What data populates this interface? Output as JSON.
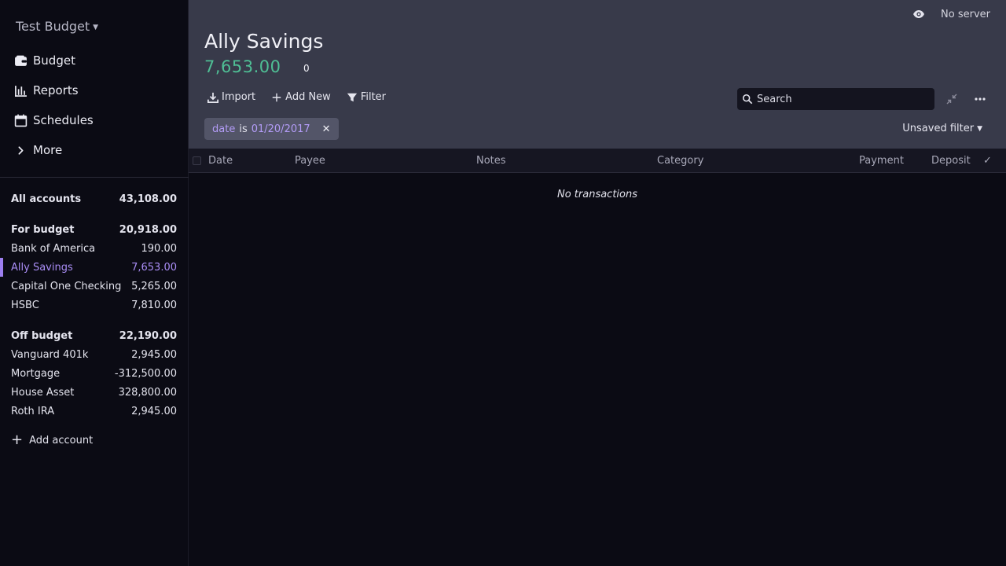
{
  "sidebar": {
    "budget_name": "Test Budget",
    "nav": [
      {
        "label": "Budget",
        "icon": "wallet-icon"
      },
      {
        "label": "Reports",
        "icon": "bar-chart-icon"
      },
      {
        "label": "Schedules",
        "icon": "calendar-icon"
      },
      {
        "label": "More",
        "icon": "chevron-right-icon"
      }
    ],
    "all_accounts": {
      "label": "All accounts",
      "amount": "43,108.00"
    },
    "for_budget": {
      "label": "For budget",
      "amount": "20,918.00",
      "accounts": [
        {
          "name": "Bank of America",
          "amount": "190.00"
        },
        {
          "name": "Ally Savings",
          "amount": "7,653.00"
        },
        {
          "name": "Capital One Checking",
          "amount": "5,265.00"
        },
        {
          "name": "HSBC",
          "amount": "7,810.00"
        }
      ]
    },
    "off_budget": {
      "label": "Off budget",
      "amount": "22,190.00",
      "accounts": [
        {
          "name": "Vanguard 401k",
          "amount": "2,945.00"
        },
        {
          "name": "Mortgage",
          "amount": "-312,500.00"
        },
        {
          "name": "House Asset",
          "amount": "328,800.00"
        },
        {
          "name": "Roth IRA",
          "amount": "2,945.00"
        }
      ]
    },
    "add_account": "Add account"
  },
  "header": {
    "server_status": "No server",
    "account_title": "Ally Savings",
    "balance": "7,653.00",
    "cleared_count": "0",
    "toolbar": {
      "import": "Import",
      "add_new": "Add New",
      "filter": "Filter"
    },
    "search_placeholder": "Search",
    "filter_chip": {
      "field": "date",
      "op": "is",
      "value": "01/20/2017"
    },
    "unsaved_filter": "Unsaved filter"
  },
  "table": {
    "columns": {
      "date": "Date",
      "payee": "Payee",
      "notes": "Notes",
      "category": "Category",
      "payment": "Payment",
      "deposit": "Deposit",
      "cleared": "✓"
    },
    "empty_message": "No transactions"
  },
  "colors": {
    "accent": "#9d7ff0",
    "positive": "#4fbf95",
    "header_bg": "#383a4a",
    "sidebar_bg": "#0b0b14"
  }
}
